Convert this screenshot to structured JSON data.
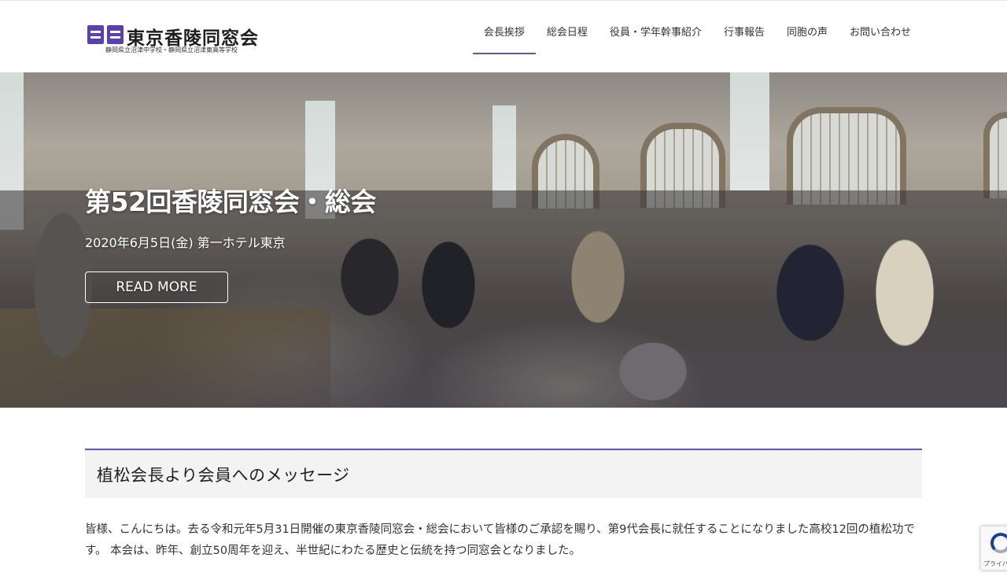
{
  "brand": {
    "title": "東京香陵同窓会",
    "subtitle": "静岡県立沼津中学校・静岡県立沼津東高等学校",
    "accent_color": "#6a4fc3"
  },
  "nav": {
    "items": [
      {
        "label": "会長挨拶",
        "active": true
      },
      {
        "label": "総会日程",
        "active": false
      },
      {
        "label": "役員・学年幹事紹介",
        "active": false
      },
      {
        "label": "行事報告",
        "active": false
      },
      {
        "label": "同胞の声",
        "active": false
      },
      {
        "label": "お問い合わせ",
        "active": false
      }
    ]
  },
  "hero": {
    "title": "第52回香陵同窓会・総会",
    "date": "2020年6月5日(金) 第一ホテル東京",
    "button_label": "READ MORE"
  },
  "section": {
    "heading": "植松会長より会員へのメッセージ",
    "paragraph_1": "皆様、こんにちは。去る令和元年5月31日開催の東京香陵同窓会・総会において皆様のご承認を賜り、第9代会長に就任することになりました高校12回の植松功です。 本会は、昨年、創立50周年を迎え、半世紀にわたる歴史と伝統を持つ同窓会となりました。"
  },
  "recaptcha": {
    "label": "プライバシー"
  }
}
